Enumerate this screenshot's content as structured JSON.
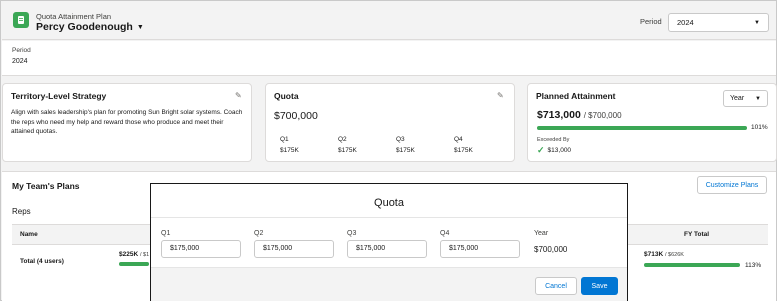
{
  "header": {
    "app_subtitle": "Quota Attainment Plan",
    "owner_name": "Percy Goodenough",
    "period_label": "Period",
    "period_value": "2024"
  },
  "period_block": {
    "label": "Period",
    "value": "2024"
  },
  "strategy": {
    "title": "Territory-Level Strategy",
    "text": "Align with sales leadership's plan for promoting Sun Bright solar systems. Coach the reps who need my help and reward those who produce and meet their attained quotas."
  },
  "quota": {
    "title": "Quota",
    "amount": "$700,000",
    "quarters": [
      {
        "label": "Q1",
        "value": "$175K"
      },
      {
        "label": "Q2",
        "value": "$175K"
      },
      {
        "label": "Q3",
        "value": "$175K"
      },
      {
        "label": "Q4",
        "value": "$175K"
      }
    ]
  },
  "attainment": {
    "title": "Planned Attainment",
    "amount": "$713,000",
    "of_amount": "/ $700,000",
    "view_select": "Year",
    "percent_label": "101%",
    "progress": 1.0,
    "exceeded_label": "Exceeded By",
    "exceeded_value": "$13,000"
  },
  "team": {
    "title": "My Team's Plans",
    "customize_label": "Customize Plans",
    "reps_label": "Reps",
    "col_name": "Name",
    "col_fy_total": "FY Total",
    "total_row_label": "Total (4 users)",
    "q1_total": "$225K",
    "q1_sub": "/ $1",
    "fy_total": "$713K",
    "fy_sub": "/ $626K",
    "fy_percent": "113%",
    "fy_progress": 1.0
  },
  "modal": {
    "title": "Quota",
    "fields": [
      {
        "label": "Q1",
        "value": "$175,000"
      },
      {
        "label": "Q2",
        "value": "$175,000"
      },
      {
        "label": "Q3",
        "value": "$175,000"
      },
      {
        "label": "Q4",
        "value": "$175,000"
      }
    ],
    "year_label": "Year",
    "year_value": "$700,000",
    "cancel_label": "Cancel",
    "save_label": "Save"
  },
  "colors": {
    "accent": "#0176d3",
    "progress": "#3ba755"
  }
}
